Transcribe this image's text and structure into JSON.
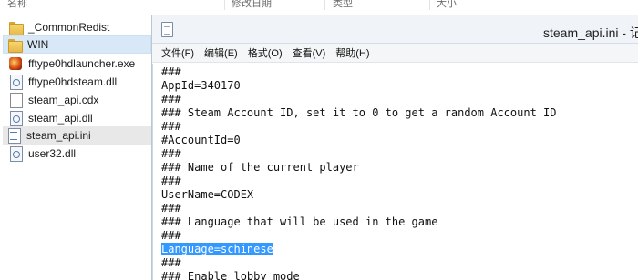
{
  "explorer": {
    "columns": [
      {
        "label": "名称"
      },
      {
        "label": "修改日期"
      },
      {
        "label": "类型"
      },
      {
        "label": "大小"
      }
    ],
    "files": [
      {
        "name": "_CommonRedist",
        "icon": "folder-icon"
      },
      {
        "name": "WIN",
        "icon": "folder-icon"
      },
      {
        "name": "fftype0hdlauncher.exe",
        "icon": "app-icon"
      },
      {
        "name": "fftype0hdsteam.dll",
        "icon": "dll-file-icon"
      },
      {
        "name": "steam_api.cdx",
        "icon": "file-icon"
      },
      {
        "name": "steam_api.dll",
        "icon": "dll-file-icon"
      },
      {
        "name": "steam_api.ini",
        "icon": "ini-file-icon"
      },
      {
        "name": "user32.dll",
        "icon": "dll-file-icon"
      }
    ]
  },
  "notepad": {
    "title": "steam_api.ini - 记",
    "menu": [
      "文件(F)",
      "编辑(E)",
      "格式(O)",
      "查看(V)",
      "帮助(H)"
    ],
    "lines": [
      "###",
      "AppId=340170",
      "###",
      "### Steam Account ID, set it to 0 to get a random Account ID",
      "###",
      "#AccountId=0",
      "###",
      "### Name of the current player",
      "###",
      "UserName=CODEX",
      "###",
      "### Language that will be used in the game",
      "###",
      "Language=schinese",
      "###",
      "### Enable lobby mode"
    ],
    "selected_line": "Language=schinese"
  },
  "colors": {
    "selection": "#3399ff",
    "explorer_selected": "#d8e8f6"
  }
}
